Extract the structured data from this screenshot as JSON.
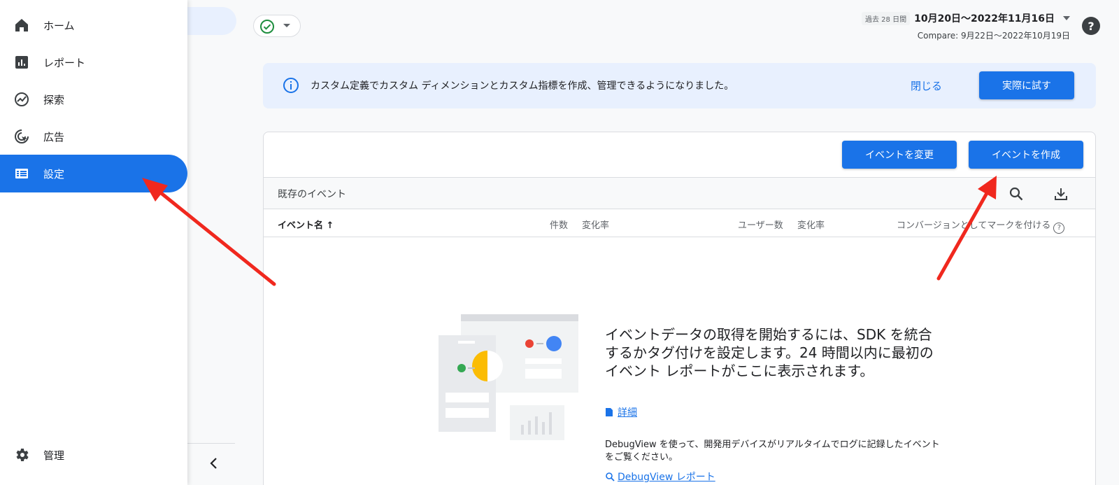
{
  "nav": {
    "items": [
      {
        "label": "ホーム",
        "icon": "home-icon"
      },
      {
        "label": "レポート",
        "icon": "bar-chart-icon"
      },
      {
        "label": "探索",
        "icon": "explore-icon"
      },
      {
        "label": "広告",
        "icon": "ads-icon"
      },
      {
        "label": "設定",
        "icon": "configure-icon",
        "active": true
      }
    ],
    "admin": {
      "label": "管理",
      "icon": "gear-icon"
    }
  },
  "header": {
    "date_badge": "過去 28 日間",
    "date_range": "10月20日〜2022年11月16日",
    "compare": "Compare: 9月22日〜2022年10月19日",
    "help": "?"
  },
  "banner": {
    "text": "カスタム定義でカスタム ディメンションとカスタム指標を作成、管理できるようになりました。",
    "close_label": "閉じる",
    "try_label": "実際に試す"
  },
  "events": {
    "modify_label": "イベントを変更",
    "create_label": "イベントを作成",
    "section_title": "既存のイベント",
    "columns": {
      "name": "イベント名",
      "count": "件数",
      "count_change": "変化率",
      "users": "ユーザー数",
      "users_change": "変化率",
      "conversion": "コンバージョンとしてマークを付ける"
    },
    "empty_title": "イベントデータの取得を開始するには、SDK を統合するかタグ付けを設定します。24 時間以内に最初のイベント レポートがここに表示されます。",
    "details_link": "詳細",
    "debug_text": "DebugView を使って、開発用デバイスがリアルタイムでログに記録したイベントをご覧ください。",
    "debug_link": "DebugView レポート"
  },
  "colors": {
    "accent": "#1a73e8",
    "annotation_arrow": "#f0281e",
    "status_ok": "#1e8e3e"
  }
}
